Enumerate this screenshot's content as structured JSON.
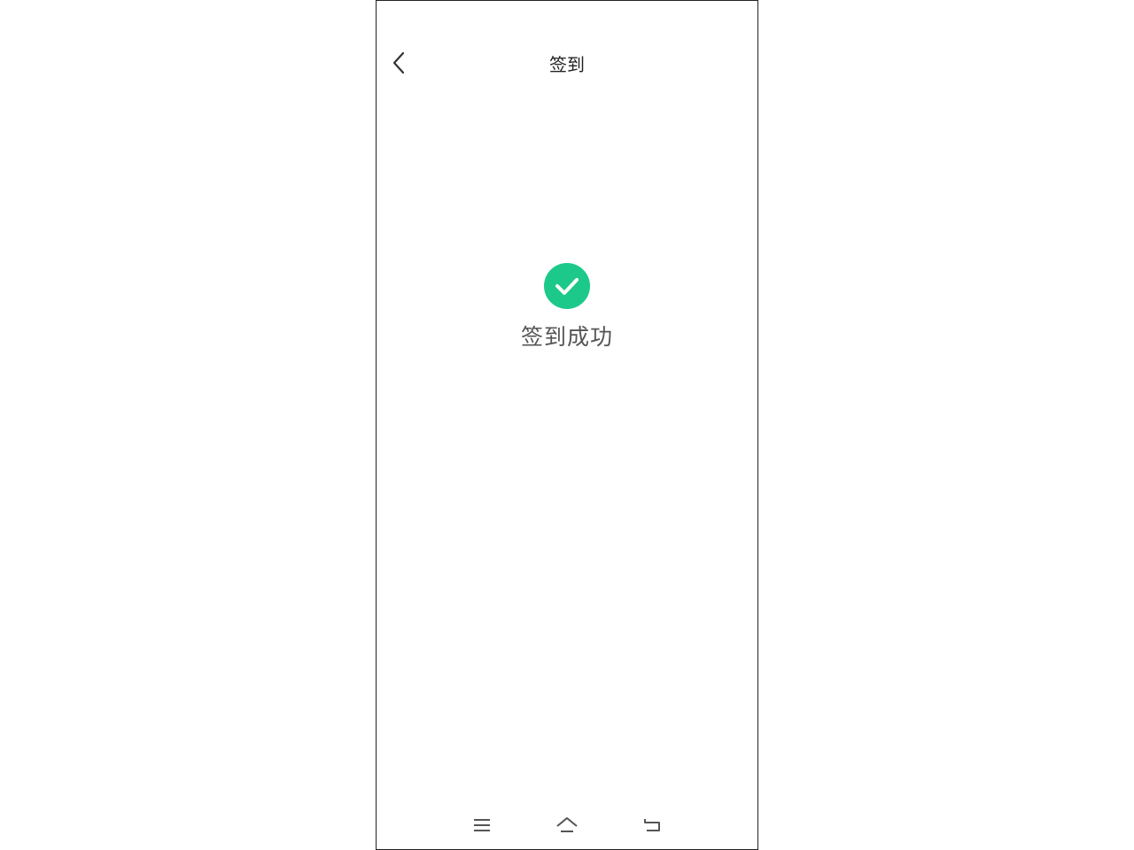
{
  "header": {
    "title": "签到",
    "back_icon": "chevron-left-icon"
  },
  "result": {
    "icon": "check-circle-icon",
    "icon_color": "#1dc98a",
    "message": "签到成功"
  },
  "system_nav": {
    "menu_icon": "menu-icon",
    "home_icon": "home-icon",
    "back_icon": "return-icon",
    "icon_color": "#555555"
  }
}
